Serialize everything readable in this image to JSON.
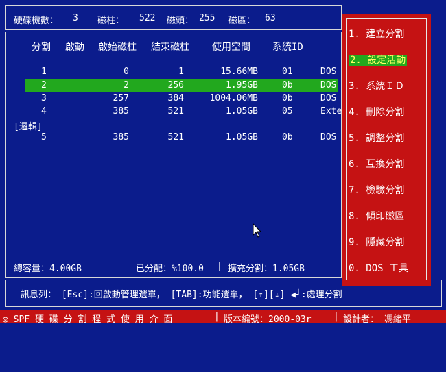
{
  "header": {
    "cyl_label": "硬碟機數：",
    "disk_count": "3",
    "cylinder_label": "磁柱：",
    "cylinder_value": "522",
    "head_label": "磁頭：",
    "head_value": "255",
    "sector_label": "磁區：",
    "sector_value": "63"
  },
  "table": {
    "columns": [
      "分割",
      "啟動",
      "啟始磁柱",
      "結束磁柱",
      "使用空間",
      "系統ID"
    ],
    "rows": [
      {
        "part": "1",
        "boot": "",
        "start": "0",
        "end": "1",
        "size": "15.66MB",
        "sysid": "01",
        "type": "DOS",
        "selected": false
      },
      {
        "part": "2",
        "boot": "",
        "start": "2",
        "end": "256",
        "size": "1.95GB",
        "sysid": "0b",
        "type": "DOS",
        "selected": true
      },
      {
        "part": "3",
        "boot": "",
        "start": "257",
        "end": "384",
        "size": "1004.06MB",
        "sysid": "0b",
        "type": "DOS",
        "selected": false
      },
      {
        "part": "4",
        "boot": "",
        "start": "385",
        "end": "521",
        "size": "1.05GB",
        "sysid": "05",
        "type": "Exte",
        "selected": false
      },
      {
        "part": "5",
        "boot": "",
        "start": "385",
        "end": "521",
        "size": "1.05GB",
        "sysid": "0b",
        "type": "DOS",
        "selected": false
      }
    ],
    "logical_label": "[邏輯]"
  },
  "summary": {
    "total": "總容量：4.00GB",
    "allocated": "已分配：%100.0",
    "extended": "擴充分割：1.05GB"
  },
  "menu": {
    "items": [
      "1. 建立分割",
      "2. 設定活動",
      "3. 系統ＩＤ",
      "4. 刪除分割",
      "5. 調整分割",
      "6. 互換分割",
      "7. 檢驗分割",
      "8. 傾印磁區",
      "9. 隱藏分割",
      "0. DOS 工具"
    ],
    "active_index": 1
  },
  "message": {
    "text": "訊息列： [Esc]:回啟動管理選單， [TAB]:功能選單， [↑][↓] ◀┘:處理分割"
  },
  "status": {
    "title": "◎ SPF 硬 碟 分 割 程 式 使 用 介 面",
    "version": "版本編號：2000-03r",
    "designer": "設計者： 馮緒平"
  },
  "colors": {
    "background": "#0b1c8c",
    "highlight": "#22a81e",
    "menu": "#c51213"
  }
}
